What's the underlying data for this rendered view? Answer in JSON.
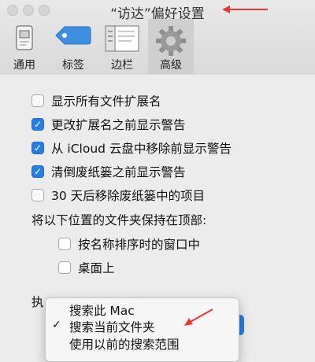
{
  "window": {
    "title": "“访达”偏好设置"
  },
  "tabs": [
    {
      "label": "通用",
      "icon": "general-icon",
      "active": false
    },
    {
      "label": "标签",
      "icon": "tag-icon",
      "active": false
    },
    {
      "label": "边栏",
      "icon": "sidebar-icon",
      "active": false
    },
    {
      "label": "高级",
      "icon": "gear-icon",
      "active": true
    }
  ],
  "options": [
    {
      "label": "显示所有文件扩展名",
      "checked": false
    },
    {
      "label": "更改扩展名之前显示警告",
      "checked": true
    },
    {
      "label": "从 iCloud 云盘中移除前显示警告",
      "checked": true
    },
    {
      "label": "清倒废纸篓之前显示警告",
      "checked": true
    },
    {
      "label": "30 天后移除废纸篓中的项目",
      "checked": false
    }
  ],
  "folders_on_top": {
    "heading": "将以下位置的文件夹保持在顶部:",
    "items": [
      {
        "label": "按名称排序时的窗口中",
        "checked": false
      },
      {
        "label": "桌面上",
        "checked": false
      }
    ]
  },
  "search": {
    "label_partial": "执",
    "menu": [
      {
        "label": "搜索此 Mac",
        "selected": false
      },
      {
        "label": "搜索当前文件夹",
        "selected": true
      },
      {
        "label": "使用以前的搜索范围",
        "selected": false
      }
    ]
  },
  "colors": {
    "accent": "#2a7de1",
    "annotation_arrow": "#e53935"
  }
}
